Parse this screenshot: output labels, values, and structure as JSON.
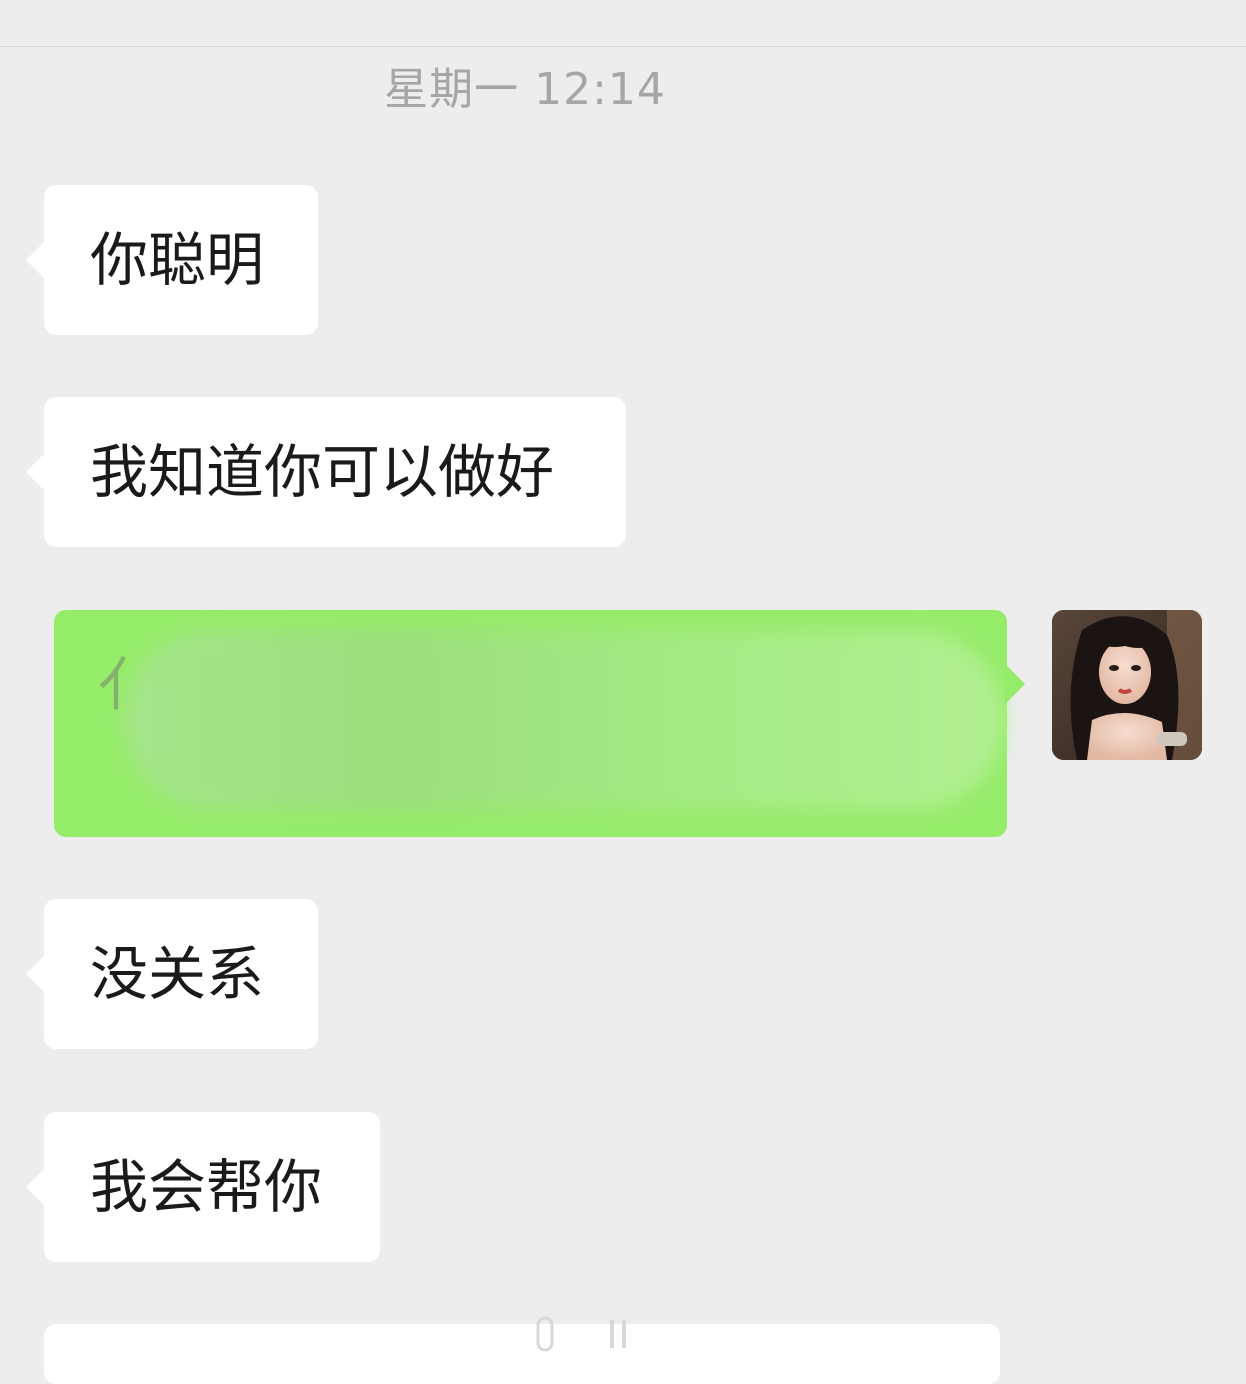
{
  "chat": {
    "timestamp": "星期一 12:14",
    "messages": [
      {
        "direction": "incoming",
        "text": "你聪明"
      },
      {
        "direction": "incoming",
        "text": "我知道你可以做好"
      },
      {
        "direction": "outgoing",
        "text": "",
        "blurred": true,
        "visible_fragment": "亻"
      },
      {
        "direction": "incoming",
        "text": "没关系"
      },
      {
        "direction": "incoming",
        "text": "我会帮你"
      }
    ]
  },
  "colors": {
    "background": "#ededed",
    "incoming_bubble": "#ffffff",
    "outgoing_bubble": "#95ec69",
    "timestamp_text": "#a6a6a6",
    "message_text": "#1a1a1a"
  },
  "icons": {
    "avatar": "user-avatar-photo"
  }
}
